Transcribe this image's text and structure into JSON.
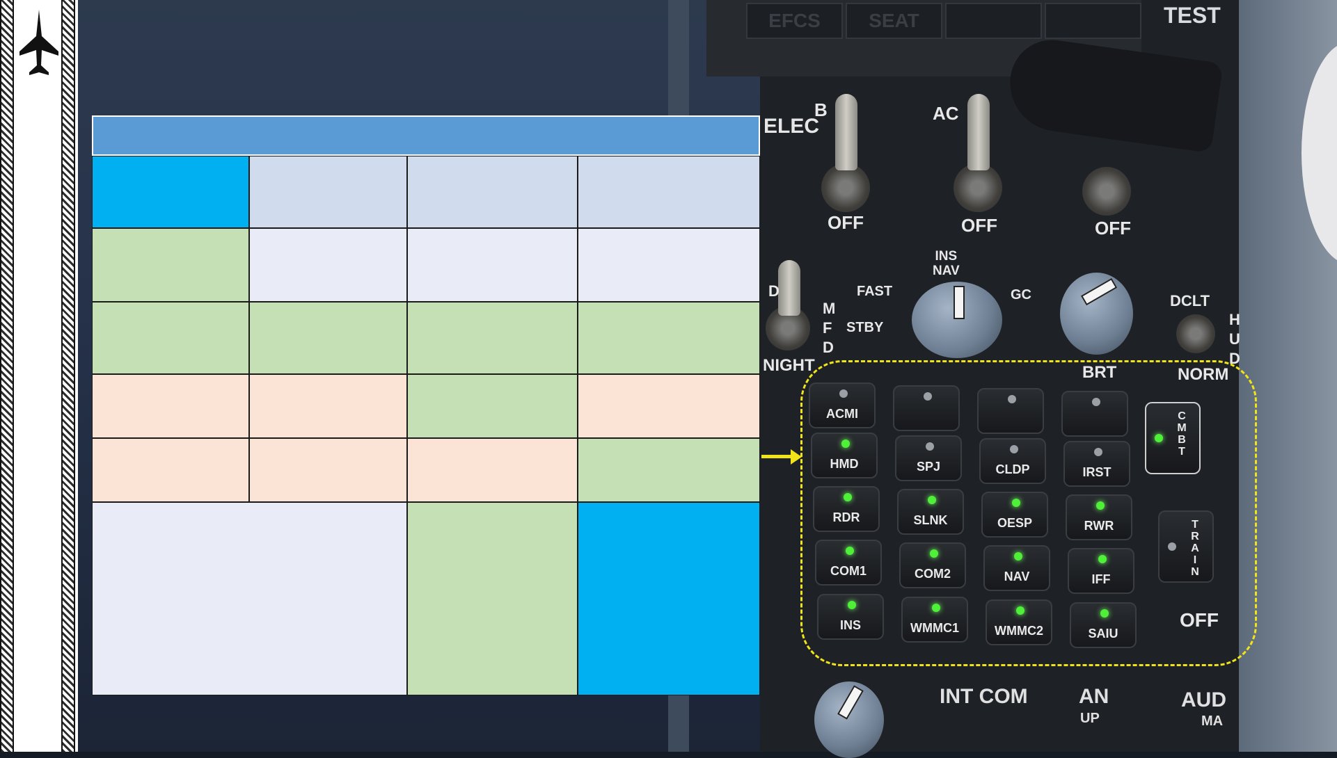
{
  "colors": {
    "header": "#5b9bd5",
    "cyan": "#00b0f0",
    "light_blue": "#d0dcee",
    "pale": "#e9ebf6",
    "green": "#c5e0b4",
    "peach": "#fbe3d6",
    "highlight": "#f0e31a",
    "lamp_on": "#4ef038",
    "lamp_off": "#9aa0a6"
  },
  "nav": {
    "icon": "jet-aircraft-icon"
  },
  "cockpit": {
    "top_slots": [
      "EFCS",
      "SEAT",
      "",
      ""
    ],
    "test_label": "TEST",
    "elec_label": "ELEC",
    "toggle_labels": [
      "B",
      "AC"
    ],
    "off_labels": [
      "OFF",
      "OFF",
      "OFF"
    ],
    "mfd": {
      "d_label": "D",
      "mfd_label": "MFD",
      "night_label": "NIGHT"
    },
    "ins": {
      "ins_nav": "INS\nNAV",
      "fast": "FAST",
      "stby": "STBY",
      "gc": "GC"
    },
    "brt_label": "BRT",
    "hud": {
      "dclt": "DCLT",
      "hud": "HUD",
      "norm": "NORM"
    },
    "buttons": [
      {
        "label": "ACMI",
        "on": false
      },
      {
        "label": "",
        "on": false
      },
      {
        "label": "",
        "on": false
      },
      {
        "label": "",
        "on": false
      },
      {
        "label": "HMD",
        "on": true
      },
      {
        "label": "SPJ",
        "on": false
      },
      {
        "label": "CLDP",
        "on": false
      },
      {
        "label": "IRST",
        "on": false
      },
      {
        "label": "RDR",
        "on": true
      },
      {
        "label": "SLNK",
        "on": true
      },
      {
        "label": "OESP",
        "on": true
      },
      {
        "label": "RWR",
        "on": true
      },
      {
        "label": "COM1",
        "on": true
      },
      {
        "label": "COM2",
        "on": true
      },
      {
        "label": "NAV",
        "on": true
      },
      {
        "label": "IFF",
        "on": true
      },
      {
        "label": "INS",
        "on": true
      },
      {
        "label": "WMMC1",
        "on": true
      },
      {
        "label": "WMMC2",
        "on": true
      },
      {
        "label": "SAIU",
        "on": true
      }
    ],
    "cmbt": {
      "label": "CMBT",
      "on": true
    },
    "train": {
      "label": "TRAIN",
      "on": false
    },
    "off_label": "OFF",
    "bottom": {
      "int_com": "INT COM",
      "an": "AN",
      "up": "UP",
      "audio": "AUD",
      "ma": "MA"
    }
  },
  "table": {
    "rows": 7,
    "columns": 4
  }
}
